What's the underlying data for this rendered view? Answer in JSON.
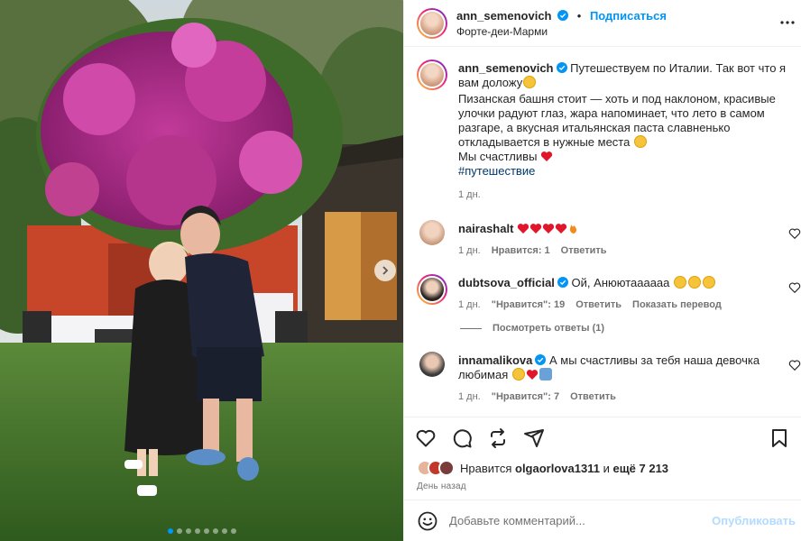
{
  "post": {
    "author": "ann_semenovich",
    "follow_label": "Подписаться",
    "separator": "•",
    "location": "Форте-деи-Марми"
  },
  "caption": {
    "username": "ann_semenovich",
    "line1": "Путешествуем по Италии. Так вот что я вам доложу",
    "line2": "Пизанская башня стоит — хоть и под наклоном, красивые улочки радуют глаз, жара напоминает, что лето в самом разгаре, а вкусная итальянская паста славненько откладывается в нужные места",
    "line3": "Мы счастливы",
    "hashtag": "#путешествие",
    "time": "1 дн."
  },
  "comments": [
    {
      "username": "nairashalt",
      "text": "",
      "time": "1 дн.",
      "likes": "Нравится: 1",
      "reply": "Ответить"
    },
    {
      "username": "dubtsova_official",
      "text": "Ой, Анюютаааааа",
      "time": "1 дн.",
      "likes": "\"Нравится\": 19",
      "reply": "Ответить",
      "translate": "Показать перевод",
      "view_replies": "Посмотреть ответы (1)"
    },
    {
      "username": "innamalikova",
      "text": "А мы счастливы за тебя наша девочка любимая",
      "time": "1 дн.",
      "likes": "\"Нравится\": 7",
      "reply": "Ответить"
    }
  ],
  "likes_bar": {
    "prefix": "Нравится",
    "user": "olgaorlova1311",
    "and_text": "и",
    "more": "ещё 7 213"
  },
  "date": "День назад",
  "add_comment": {
    "placeholder": "Добавьте комментарий...",
    "publish_label": "Опубликовать"
  },
  "carousel": {
    "total_slides": 8,
    "active_slide": 1
  },
  "colors": {
    "accent": "#0095f6",
    "verified": "#0095f6",
    "text": "#262626",
    "secondary": "#737373",
    "heart": "#e0162b"
  },
  "icons": [
    "verified-icon",
    "more-icon",
    "heart-icon",
    "comment-icon",
    "share-icon",
    "send-icon",
    "bookmark-icon",
    "emoji-icon",
    "chevron-right-icon"
  ]
}
